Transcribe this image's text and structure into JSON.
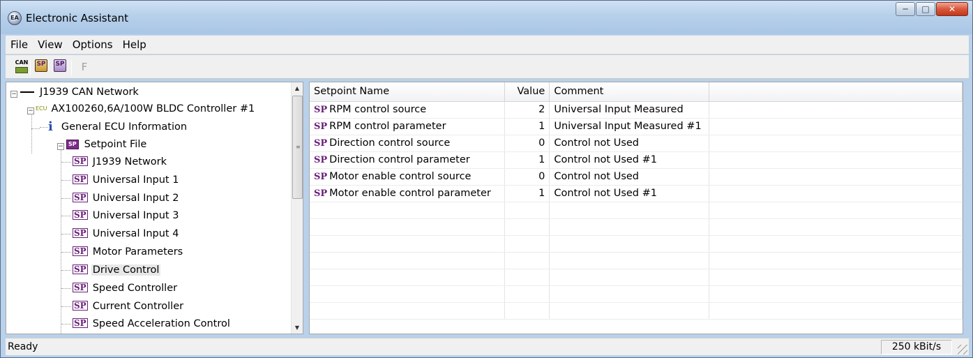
{
  "window": {
    "title": "Electronic Assistant",
    "icon_text": "EA",
    "controls": [
      "minimize-icon",
      "maximize-icon",
      "close-icon"
    ]
  },
  "menu": [
    "File",
    "View",
    "Options",
    "Help"
  ],
  "toolbar": {
    "can_label": "CAN",
    "sp_label": "SP",
    "f_label": "F"
  },
  "tree": {
    "network": "J1939 CAN Network",
    "ecu_tag": "ECU",
    "ecu": "AX100260,6A/100W BLDC Controller #1",
    "info": "General ECU Information",
    "setpoint_file": "Setpoint File",
    "sp_tag": "SP",
    "items": [
      "J1939 Network",
      "Universal Input 1",
      "Universal Input 2",
      "Universal Input 3",
      "Universal Input 4",
      "Motor Parameters",
      "Drive Control",
      "Speed Controller",
      "Current Controller",
      "Speed Acceleration Control"
    ],
    "selected": "Drive Control"
  },
  "grid": {
    "columns": [
      "Setpoint Name",
      "Value",
      "Comment"
    ],
    "sp_tag": "SP",
    "rows": [
      {
        "name": "RPM control source",
        "value": "2",
        "comment": "Universal Input Measured"
      },
      {
        "name": "RPM control parameter",
        "value": "1",
        "comment": "Universal Input Measured #1"
      },
      {
        "name": "Direction control source",
        "value": "0",
        "comment": "Control not Used"
      },
      {
        "name": "Direction control parameter",
        "value": "1",
        "comment": "Control not Used #1"
      },
      {
        "name": "Motor enable control source",
        "value": "0",
        "comment": "Control not Used"
      },
      {
        "name": "Motor enable control parameter",
        "value": "1",
        "comment": "Control not Used #1"
      }
    ]
  },
  "status": {
    "text": "Ready",
    "baud": "250 kBit/s"
  }
}
